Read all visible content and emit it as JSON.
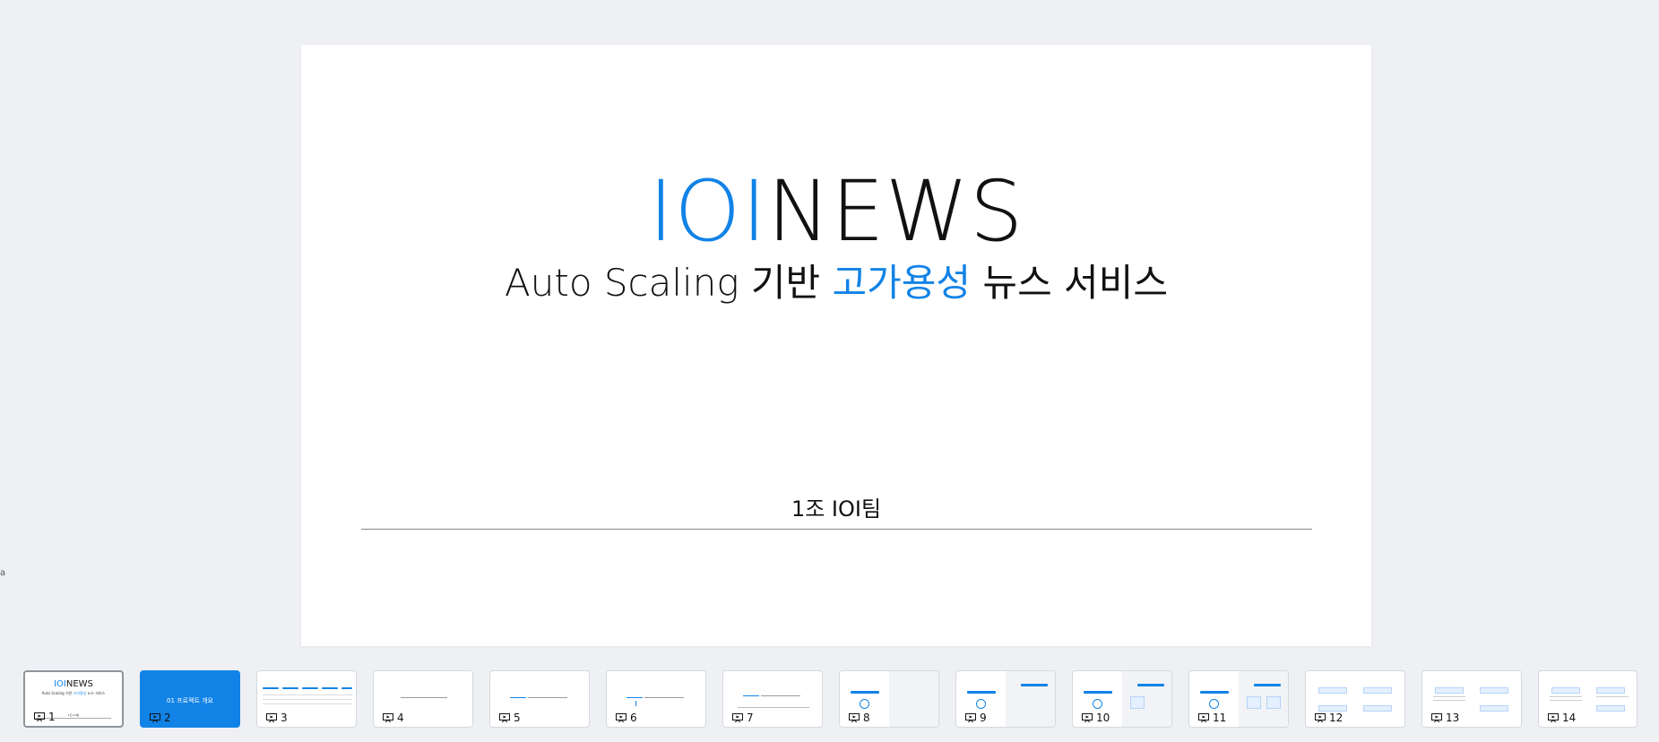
{
  "slide": {
    "title_accent": "IOI",
    "title_rest": "NEWS",
    "subtitle_pre": "Auto Scaling 기반 ",
    "subtitle_accent": "고가용성",
    "subtitle_post": " 뉴스 서비스",
    "team": "1조 IOI팀"
  },
  "side_letter": "a",
  "colors": {
    "accent": "#1283e6",
    "background": "#eef0f3"
  },
  "thumbnails": [
    {
      "number": "1",
      "selected": true
    },
    {
      "number": "2",
      "text": "01 프로젝트 개요"
    },
    {
      "number": "3"
    },
    {
      "number": "4"
    },
    {
      "number": "5"
    },
    {
      "number": "6"
    },
    {
      "number": "7"
    },
    {
      "number": "8"
    },
    {
      "number": "9"
    },
    {
      "number": "10"
    },
    {
      "number": "11"
    },
    {
      "number": "12"
    },
    {
      "number": "13"
    },
    {
      "number": "14"
    }
  ]
}
